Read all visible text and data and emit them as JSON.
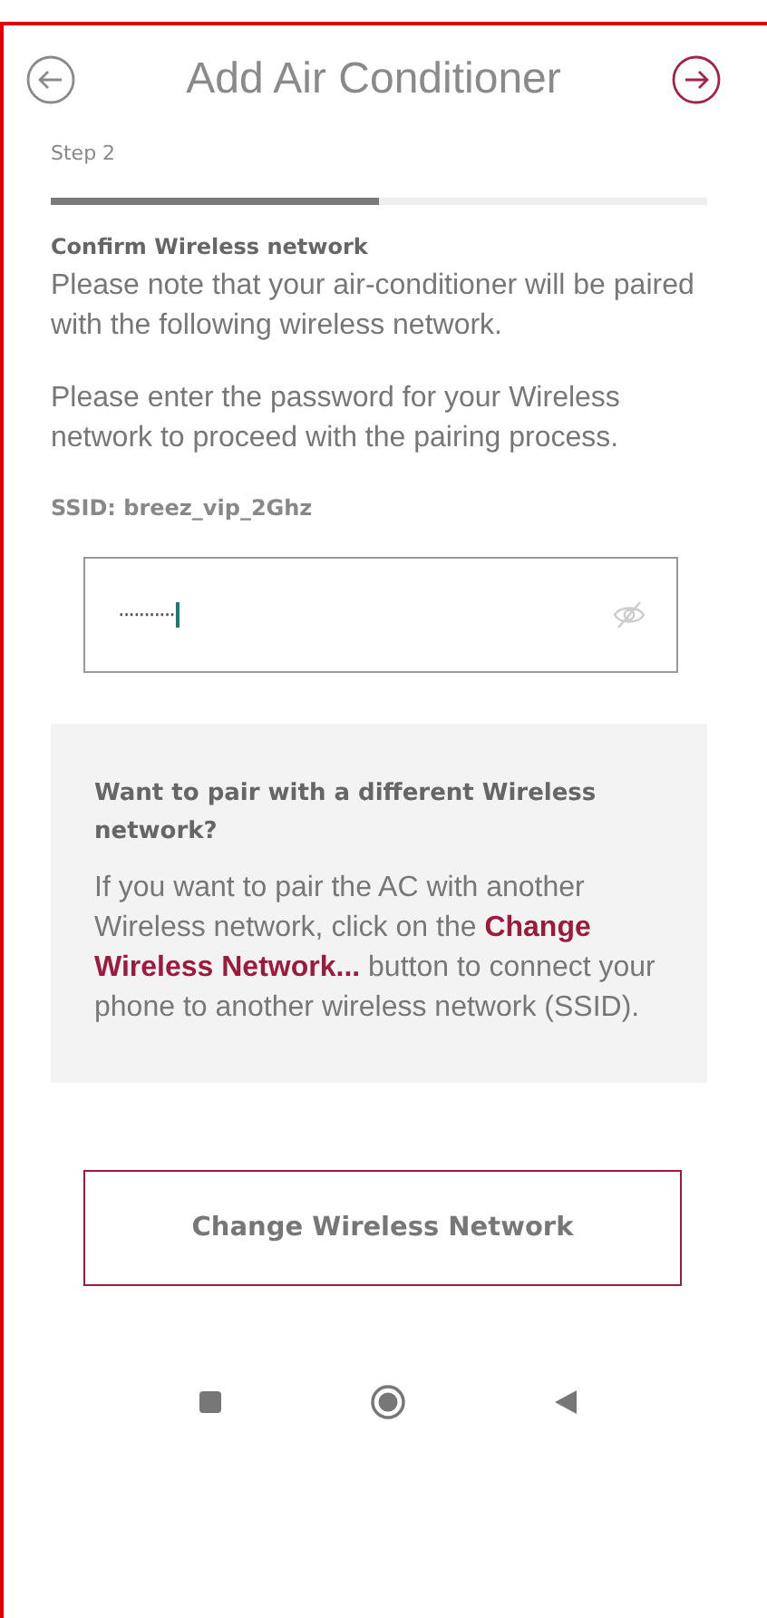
{
  "header": {
    "title": "Add Air Conditioner"
  },
  "step": {
    "label": "Step 2",
    "level": 0.5
  },
  "confirm": {
    "heading": "Confirm Wireless network",
    "text": "Please note that your air-conditioner will be paired with the following wireless network.",
    "prompt": "Please enter the password for your Wireless network to proceed with the pairing process."
  },
  "ssid": "SSID: breez_vip_2Ghz",
  "password": {
    "value": "···········",
    "visible": false
  },
  "info": {
    "heading": "Want to pair with a different Wireless network?",
    "text": "If you want to pair the AC with another Wireless network, click on the **Change Wireless Network...** button to connect your phone to another wireless network (SSID)."
  },
  "button": "Change Wireless Network"
}
